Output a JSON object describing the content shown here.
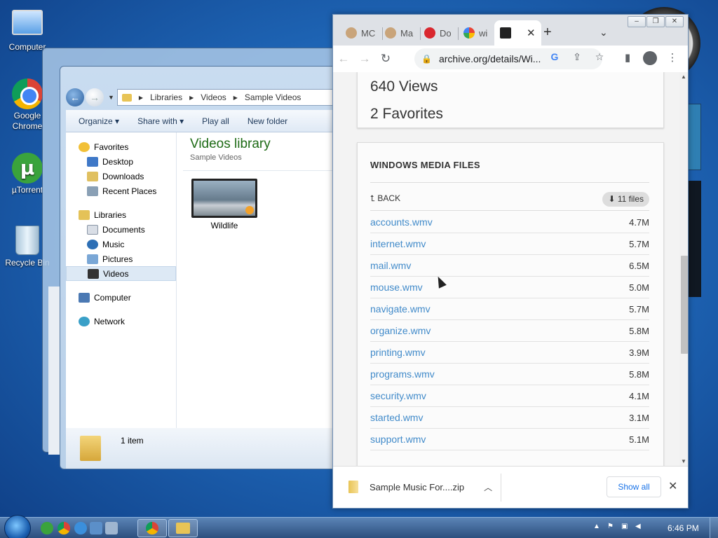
{
  "desktop": {
    "icons": [
      {
        "label": "Computer",
        "icon": "computer-icon"
      },
      {
        "label": "Google Chrome",
        "icon": "chrome-icon"
      },
      {
        "label": "µTorrent",
        "icon": "utorrent-icon"
      },
      {
        "label": "Recycle Bin",
        "icon": "recycle-bin-icon"
      }
    ]
  },
  "explorer": {
    "breadcrumb": [
      "Libraries",
      "Videos",
      "Sample Videos"
    ],
    "toolbar": {
      "organize": "Organize ▾",
      "share": "Share with ▾",
      "play_all": "Play all",
      "new_folder": "New folder"
    },
    "nav": {
      "favorites": "Favorites",
      "desktop": "Desktop",
      "downloads": "Downloads",
      "recent": "Recent Places",
      "libraries": "Libraries",
      "documents": "Documents",
      "music": "Music",
      "pictures": "Pictures",
      "videos": "Videos",
      "computer": "Computer",
      "network": "Network"
    },
    "library_title": "Videos library",
    "library_sub": "Sample Videos",
    "item_name": "Wildlife",
    "status": "1 item"
  },
  "chrome": {
    "tabs": [
      {
        "label": "MC",
        "icon": "hamster-icon"
      },
      {
        "label": "Ma",
        "icon": "hamster-icon"
      },
      {
        "label": "Do",
        "icon": "mega-icon"
      },
      {
        "label": "wi",
        "icon": "google-icon"
      }
    ],
    "active_tab_icon": "archive-icon",
    "url": "archive.org/details/Wi...",
    "page": {
      "views": "640 Views",
      "favorites": "2 Favorites",
      "section_title": "WINDOWS MEDIA FILES",
      "back": "BACK",
      "files_badge": "11 files",
      "files": [
        {
          "name": "accounts.wmv",
          "size": "4.7M"
        },
        {
          "name": "internet.wmv",
          "size": "5.7M"
        },
        {
          "name": "mail.wmv",
          "size": "6.5M"
        },
        {
          "name": "mouse.wmv",
          "size": "5.0M"
        },
        {
          "name": "navigate.wmv",
          "size": "5.7M"
        },
        {
          "name": "organize.wmv",
          "size": "5.8M"
        },
        {
          "name": "printing.wmv",
          "size": "3.9M"
        },
        {
          "name": "programs.wmv",
          "size": "5.8M"
        },
        {
          "name": "security.wmv",
          "size": "4.1M"
        },
        {
          "name": "started.wmv",
          "size": "3.1M"
        },
        {
          "name": "support.wmv",
          "size": "5.1M"
        }
      ]
    },
    "download": {
      "filename": "Sample Music For....zip",
      "show_all": "Show all"
    }
  },
  "taskbar": {
    "time": "6:46 PM"
  }
}
